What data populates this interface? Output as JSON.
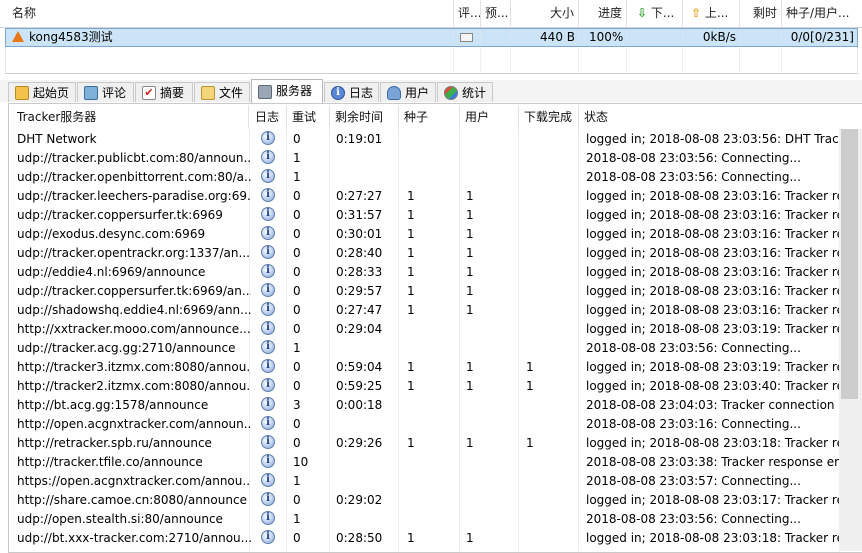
{
  "top_columns": [
    "名称",
    "评...",
    "预...",
    "大小",
    "进度",
    "下...",
    "上...",
    "剩时",
    "种子/用户..."
  ],
  "torrent": {
    "name": "kong4583测试",
    "size": "440 B",
    "progress": "100%",
    "up_speed": "0kB/s",
    "seeds_peers": "0/0[0/231]"
  },
  "tabs": [
    {
      "label": "起始页",
      "icon": "home-icon"
    },
    {
      "label": "评论",
      "icon": "comment-icon"
    },
    {
      "label": "摘要",
      "icon": "summary-icon"
    },
    {
      "label": "文件",
      "icon": "file-icon"
    },
    {
      "label": "服务器",
      "icon": "server-icon",
      "active": true
    },
    {
      "label": "日志",
      "icon": "log-icon"
    },
    {
      "label": "用户",
      "icon": "user-icon"
    },
    {
      "label": "统计",
      "icon": "stats-icon"
    }
  ],
  "tracker_columns": [
    "Tracker服务器",
    "日志",
    "重试",
    "剩余时间",
    "种子",
    "用户",
    "下载完成",
    "状态"
  ],
  "trackers": [
    {
      "url": "DHT Network",
      "retry": "0",
      "remain": "0:19:01",
      "seeds": "",
      "users": "",
      "done": "",
      "status": "logged in; 2018-08-08 23:03:56: DHT Tracker"
    },
    {
      "url": "udp://tracker.publicbt.com:80/announ...",
      "retry": "1",
      "remain": "",
      "seeds": "",
      "users": "",
      "done": "",
      "status": "2018-08-08 23:03:56: Connecting..."
    },
    {
      "url": "udp://tracker.openbittorrent.com:80/a...",
      "retry": "1",
      "remain": "",
      "seeds": "",
      "users": "",
      "done": "",
      "status": "2018-08-08 23:03:56: Connecting..."
    },
    {
      "url": "udp://tracker.leechers-paradise.org:69...",
      "retry": "0",
      "remain": "0:27:27",
      "seeds": "1",
      "users": "1",
      "done": "",
      "status": "logged in; 2018-08-08 23:03:16: Tracker retur"
    },
    {
      "url": "udp://tracker.coppersurfer.tk:6969",
      "retry": "0",
      "remain": "0:31:57",
      "seeds": "1",
      "users": "1",
      "done": "",
      "status": "logged in; 2018-08-08 23:03:16: Tracker retur"
    },
    {
      "url": "udp://exodus.desync.com:6969",
      "retry": "0",
      "remain": "0:30:01",
      "seeds": "1",
      "users": "1",
      "done": "",
      "status": "logged in; 2018-08-08 23:03:16: Tracker retur"
    },
    {
      "url": "udp://tracker.opentrackr.org:1337/an...",
      "retry": "0",
      "remain": "0:28:40",
      "seeds": "1",
      "users": "1",
      "done": "",
      "status": "logged in; 2018-08-08 23:03:16: Tracker retur"
    },
    {
      "url": "udp://eddie4.nl:6969/announce",
      "retry": "0",
      "remain": "0:28:33",
      "seeds": "1",
      "users": "1",
      "done": "",
      "status": "logged in; 2018-08-08 23:03:16: Tracker retur"
    },
    {
      "url": "udp://tracker.coppersurfer.tk:6969/an...",
      "retry": "0",
      "remain": "0:29:57",
      "seeds": "1",
      "users": "1",
      "done": "",
      "status": "logged in; 2018-08-08 23:03:16: Tracker retur"
    },
    {
      "url": "udp://shadowshq.eddie4.nl:6969/ann...",
      "retry": "0",
      "remain": "0:27:47",
      "seeds": "1",
      "users": "1",
      "done": "",
      "status": "logged in; 2018-08-08 23:03:16: Tracker retur"
    },
    {
      "url": "http://xxtracker.mooo.com/announce....",
      "retry": "0",
      "remain": "0:29:04",
      "seeds": "",
      "users": "",
      "done": "",
      "status": "logged in; 2018-08-08 23:03:19: Tracker retur"
    },
    {
      "url": "udp://tracker.acg.gg:2710/announce",
      "retry": "1",
      "remain": "",
      "seeds": "",
      "users": "",
      "done": "",
      "status": "2018-08-08 23:03:56: Connecting..."
    },
    {
      "url": "http://tracker3.itzmx.com:8080/annou...",
      "retry": "0",
      "remain": "0:59:04",
      "seeds": "1",
      "users": "1",
      "done": "1",
      "status": "logged in; 2018-08-08 23:03:19: Tracker retur"
    },
    {
      "url": "http://tracker2.itzmx.com:8080/annou...",
      "retry": "0",
      "remain": "0:59:25",
      "seeds": "1",
      "users": "1",
      "done": "1",
      "status": "logged in; 2018-08-08 23:03:40: Tracker retur"
    },
    {
      "url": "http://bt.acg.gg:1578/announce",
      "retry": "3",
      "remain": "0:00:18",
      "seeds": "",
      "users": "",
      "done": "",
      "status": "2018-08-08 23:04:03: Tracker connection errc"
    },
    {
      "url": "http://open.acgnxtracker.com/announ...",
      "retry": "0",
      "remain": "",
      "seeds": "",
      "users": "",
      "done": "",
      "status": "2018-08-08 23:03:16: Connecting..."
    },
    {
      "url": "http://retracker.spb.ru/announce",
      "retry": "0",
      "remain": "0:29:26",
      "seeds": "1",
      "users": "1",
      "done": "1",
      "status": "logged in; 2018-08-08 23:03:18: Tracker retur"
    },
    {
      "url": "http://tracker.tfile.co/announce",
      "retry": "10",
      "remain": "",
      "seeds": "",
      "users": "",
      "done": "",
      "status": "2018-08-08 23:03:38: Tracker response error:"
    },
    {
      "url": "https://open.acgnxtracker.com/annou...",
      "retry": "1",
      "remain": "",
      "seeds": "",
      "users": "",
      "done": "",
      "status": "2018-08-08 23:03:57: Connecting..."
    },
    {
      "url": "http://share.camoe.cn:8080/announce",
      "retry": "0",
      "remain": "0:29:02",
      "seeds": "",
      "users": "",
      "done": "",
      "status": "logged in; 2018-08-08 23:03:17: Tracker retur"
    },
    {
      "url": "udp://open.stealth.si:80/announce",
      "retry": "1",
      "remain": "",
      "seeds": "",
      "users": "",
      "done": "",
      "status": "2018-08-08 23:03:56: Connecting..."
    },
    {
      "url": "udp://bt.xxx-tracker.com:2710/annou...",
      "retry": "0",
      "remain": "0:28:50",
      "seeds": "1",
      "users": "1",
      "done": "",
      "status": "logged in; 2018-08-08 23:03:18: Tracker retur"
    }
  ]
}
